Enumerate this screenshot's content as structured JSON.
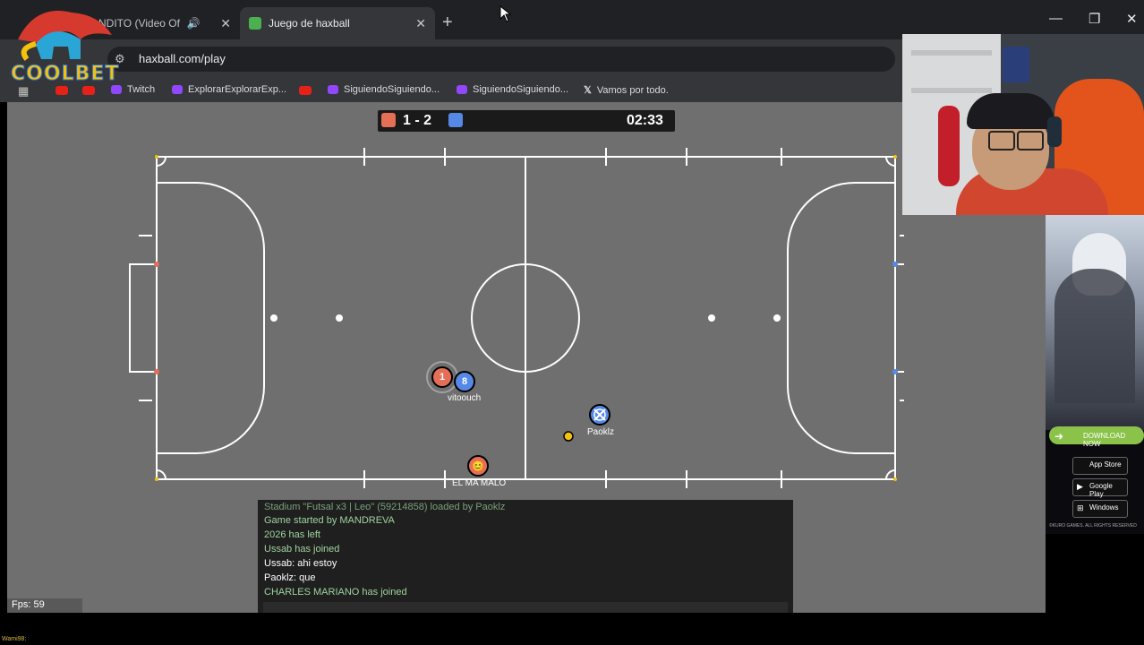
{
  "browser": {
    "tabs": [
      {
        "label": "NDITO (Video Of",
        "active": false
      },
      {
        "label": "Juego de haxball",
        "active": true
      }
    ],
    "url": "haxball.com/play",
    "bookmarks": [
      "Twitch",
      "ExplorarExplorarExp...",
      "SiguiendoSiguiendo...",
      "SiguiendoSiguiendo...",
      "Vamos por todo."
    ]
  },
  "logo": {
    "text": "COOLBET"
  },
  "scoreboard": {
    "score": "1 - 2",
    "time": "02:33",
    "red_color": "#e56e56",
    "blue_color": "#5689e5"
  },
  "players": [
    {
      "name": "",
      "number": "1",
      "team": "red"
    },
    {
      "name": "vitoouch",
      "number": "8",
      "team": "blue"
    },
    {
      "name": "Paoklz",
      "number": "",
      "team": "blue"
    },
    {
      "name": "EL MA MALO",
      "number": "",
      "team": "red"
    }
  ],
  "chat": {
    "lines": [
      {
        "text": "Stadium \"Futsal x3 | Leo\" (59214858) loaded by Paoklz",
        "color": "#9fd49f"
      },
      {
        "text": "Game started by MANDREVA",
        "color": "#9fd49f"
      },
      {
        "text": "2026 has left",
        "color": "#9fd49f"
      },
      {
        "text": "Ussab has joined",
        "color": "#9fd49f"
      },
      {
        "text": "Ussab: ahi estoy",
        "color": "#ffffff"
      },
      {
        "text": "Paoklz: que",
        "color": "#ffffff"
      },
      {
        "text": "CHARLES MARIANO has joined",
        "color": "#9fd49f"
      }
    ]
  },
  "fps": "Fps: 59",
  "ad": {
    "download": "DOWNLOAD NOW",
    "app_store": "App Store",
    "google_play": "Google Play",
    "windows": "Windows",
    "footer": "©KURO GAMES. ALL RIGHTS RESERVED"
  },
  "bottom_text": "Wami98:"
}
